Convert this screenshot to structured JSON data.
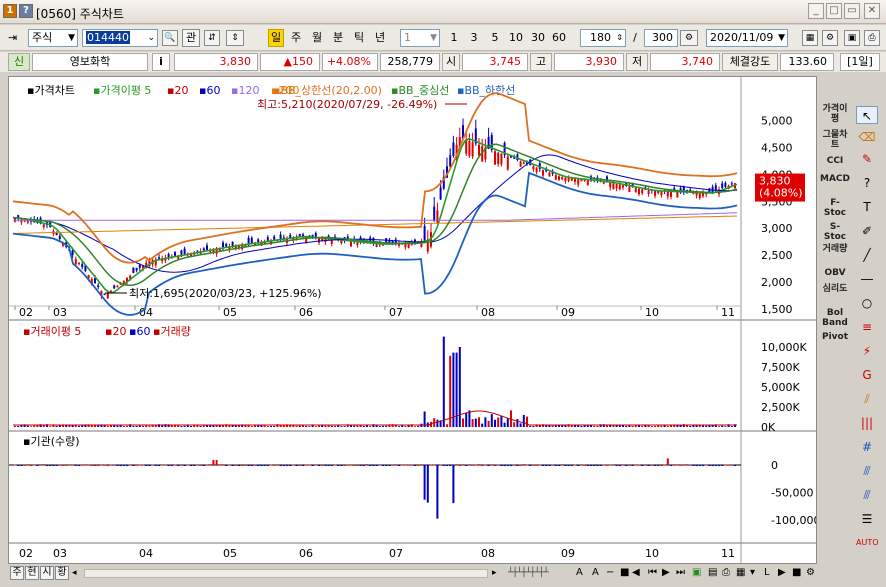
{
  "window": {
    "title": "[0560] 주식차트",
    "badge1": "1",
    "badge2": "?"
  },
  "toolbar": {
    "market_type": "주식",
    "stock_code": "014440",
    "btn_related": "관",
    "btn_min": "분",
    "btn_day": "일",
    "btn_week": "주",
    "btn_month": "월",
    "btn_minute": "분",
    "btn_tick": "틱",
    "btn_year": "년",
    "interval_value": "1",
    "quick_intervals": [
      "1",
      "3",
      "5",
      "10",
      "30",
      "60"
    ],
    "count_value": "180",
    "slash": "/",
    "total_value": "300",
    "date_value": "2020/11/09"
  },
  "quote": {
    "market_tag": "신",
    "name": "영보화학",
    "info": "i",
    "price": "3,830",
    "change": "▲150",
    "change_pct": "+4.08%",
    "volume": "258,779",
    "open_label": "시",
    "open": "3,745",
    "high_label": "고",
    "high": "3,930",
    "low_label": "저",
    "low": "3,740",
    "strength_label": "체결강도",
    "strength": "133.60",
    "period": "[1일]"
  },
  "price_panel": {
    "legend_title": "가격차트",
    "legend_ma": "가격이평 5",
    "legend_items": [
      "20",
      "60",
      "120",
      "200"
    ],
    "legend_bb_upper": "BB_상한선(20,2.00)",
    "legend_bb_mid": "BB_중심선",
    "legend_bb_lower": "BB_하한선",
    "high_annotation": "최고:5,210(2020/07/29, -26.49%)",
    "low_annotation": "최저:1,695(2020/03/23, +125.96%)",
    "y_ticks": [
      "5,000",
      "4,500",
      "4,000",
      "3,500",
      "3,000",
      "2,500",
      "2,000",
      "1,500"
    ],
    "current_price_label": "3,830",
    "current_pct_label": "(4.08%)"
  },
  "volume_panel": {
    "legend_ma": "거래이평 5",
    "legend_items": [
      "20",
      "60"
    ],
    "legend_volume": "거래량",
    "y_ticks": [
      "10,000K",
      "7,500K",
      "5,000K",
      "2,500K",
      "0K"
    ]
  },
  "inst_panel": {
    "legend": "기관(수량)",
    "y_ticks": [
      "0",
      "-50,000",
      "-100,000"
    ]
  },
  "x_ticks": [
    "02",
    "03",
    "04",
    "05",
    "06",
    "07",
    "08",
    "09",
    "10",
    "11"
  ],
  "right_indicators": [
    "가격이평",
    "그물차트",
    "CCI",
    "MACD",
    "F-Stoc",
    "S-Stoc",
    "거래량",
    "OBV",
    "심리도",
    "Bol Band",
    "Pivot"
  ],
  "status": {
    "tabs": [
      "주",
      "현",
      "시",
      "황"
    ]
  },
  "chart_data": {
    "type": "candlestick",
    "title": "",
    "x": [
      "02",
      "03",
      "04",
      "05",
      "06",
      "07",
      "08",
      "09",
      "10",
      "11"
    ],
    "price_ylim": [
      1500,
      5400
    ],
    "price_series": {
      "close_approx": [
        3200,
        3050,
        1750,
        2400,
        2650,
        2850,
        2700,
        2750,
        2800,
        4700,
        4400,
        3950,
        3850,
        3700,
        3650,
        3850
      ],
      "dates_approx": [
        "2020/02",
        "2020/03",
        "2020/03/23",
        "2020/04",
        "2020/05",
        "2020/06",
        "2020/07/01",
        "2020/07/15",
        "2020/07/20",
        "2020/07/29",
        "2020/08",
        "2020/09",
        "2020/10/01",
        "2020/10",
        "2020/11/01",
        "2020/11/09"
      ]
    },
    "volume_peaks_K": [
      {
        "x": "2020/07",
        "value": 11300
      },
      {
        "x": "2020/07",
        "value": 10000
      },
      {
        "x": "2020/07",
        "value": 9300
      },
      {
        "x": "2020/07",
        "value": 8900
      }
    ],
    "inst_min": -110000
  }
}
